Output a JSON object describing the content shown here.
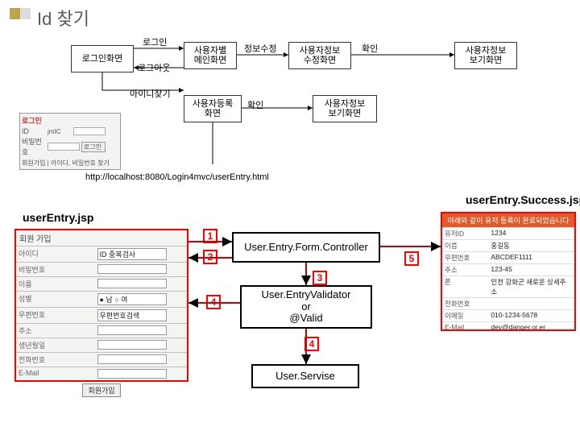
{
  "title": "Id 찾기",
  "flow": {
    "login_screen": "로그인화면",
    "login": "로그인",
    "logout": "로그아웃",
    "find_id": "아이디찾기",
    "user_main": "사용자별\n메인화면",
    "edit_info": "정보수정",
    "user_edit_screen": "사용자정보\n수정화면",
    "confirm1": "확인",
    "user_view_screen1": "사용자정보\n보기화면",
    "user_reg_screen": "사용자등록\n화면",
    "confirm2": "확인",
    "user_view_screen2": "사용자정보\n보기화면"
  },
  "url": "http://localhost:8080/Login4mvc/userEntry.html",
  "entry_jsp": "userEntry.jsp",
  "success_jsp": "userEntry.Success.jsp",
  "blocks": {
    "ctrl": "User.Entry.Form.Controller",
    "validator": "User.EntryValidator\nor\n@Valid",
    "service": "User.Servise"
  },
  "nums": {
    "n1": "1",
    "n2": "2",
    "n3": "3",
    "n4a": "4",
    "n4b": "4",
    "n5": "5"
  },
  "mini_login": {
    "title": "로그인",
    "id_lbl": "ID",
    "pw_lbl": "비밀번호",
    "id_val": "jmIC",
    "btn": "로그인",
    "hint": "회원가입 | 아이디, 비밀번호 찾기"
  },
  "form": {
    "header": "회원 가입",
    "rows": [
      {
        "k": "아이디",
        "v": "ID 중복검사"
      },
      {
        "k": "비밀번호",
        "v": ""
      },
      {
        "k": "이름",
        "v": ""
      },
      {
        "k": "성별",
        "v": "● 남   ○ 여"
      },
      {
        "k": "우편번호",
        "v": "우편번호검색"
      },
      {
        "k": "주소",
        "v": ""
      },
      {
        "k": "생년월일",
        "v": ""
      },
      {
        "k": "전화번호",
        "v": ""
      },
      {
        "k": "E-Mail",
        "v": ""
      }
    ],
    "submit": "회원가입"
  },
  "success": {
    "header": "아래와 같이 유저 등록이 완료되었습니다",
    "rows": [
      {
        "k": "유저ID",
        "v": "1234"
      },
      {
        "k": "이름",
        "v": "홍길동"
      },
      {
        "k": "우편번호",
        "v": "ABCDEF1111"
      },
      {
        "k": "주소",
        "v": "123-45"
      },
      {
        "k": "폰",
        "v": "인천 강화군 새로운 상세주소"
      },
      {
        "k": "전화번호",
        "v": ""
      },
      {
        "k": "이메일",
        "v": "010-1234-5678"
      },
      {
        "k": "E-Mail",
        "v": "dev@danger.or.er"
      }
    ]
  }
}
